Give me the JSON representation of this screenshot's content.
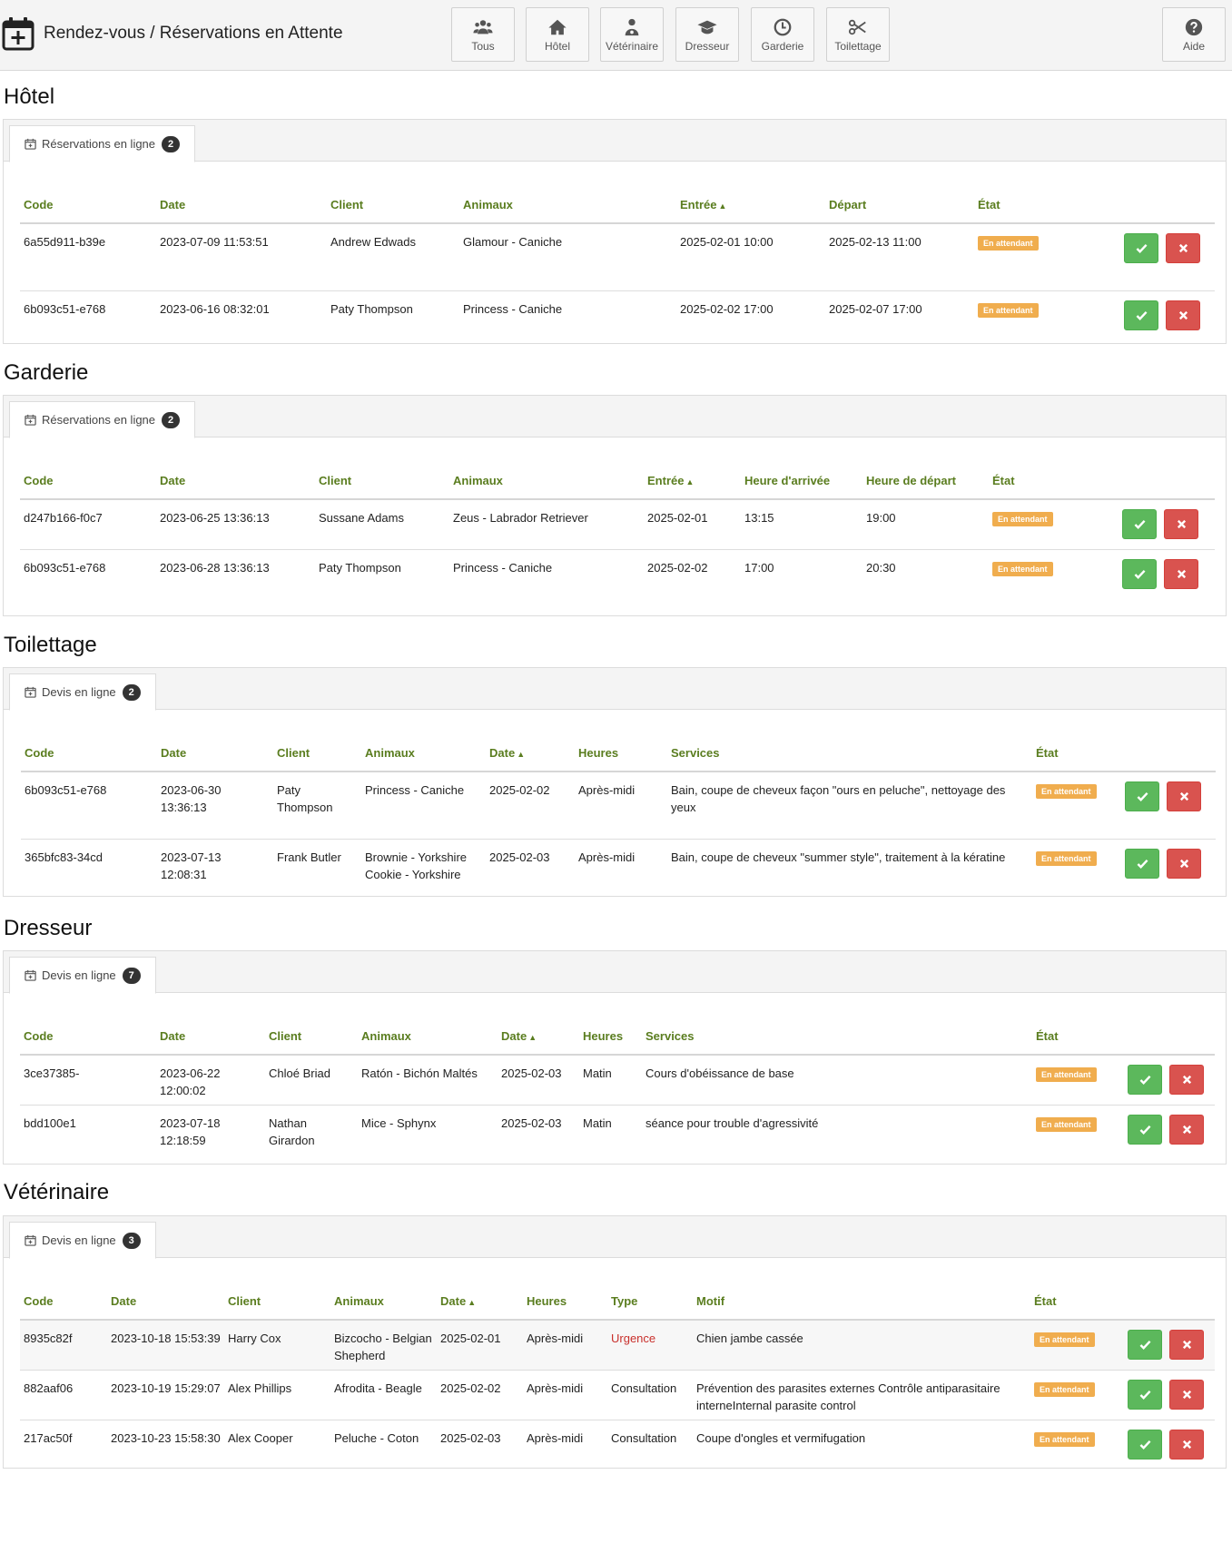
{
  "header": {
    "title": "Rendez-vous / Réservations en Attente",
    "nav": [
      {
        "label": "Tous",
        "icon": "users-icon"
      },
      {
        "label": "Hôtel",
        "icon": "home-icon"
      },
      {
        "label": "Vétérinaire",
        "icon": "doctor-icon"
      },
      {
        "label": "Dresseur",
        "icon": "graduation-cap-icon"
      },
      {
        "label": "Garderie",
        "icon": "clock-icon"
      },
      {
        "label": "Toilettage",
        "icon": "scissors-icon"
      }
    ],
    "help": {
      "label": "Aide",
      "icon": "question-icon"
    }
  },
  "status_label": "En attendant",
  "colors": {
    "accent": "#5a7d1f",
    "status": "#f0ad4e",
    "accept": "#5cb85c",
    "reject": "#d9534f",
    "urgent": "#c9302c"
  },
  "hotel": {
    "title": "Hôtel",
    "tab": {
      "label": "Réservations en ligne",
      "count": "2"
    },
    "columns": [
      "Code",
      "Date",
      "Client",
      "Animaux",
      "Entrée",
      "Départ",
      "État"
    ],
    "rows": [
      {
        "code": "6a55d911-b39e",
        "date": "2023-07-09 11:53:51",
        "client": "Andrew Edwads",
        "animals": "Glamour - Caniche",
        "in": "2025-02-01 10:00",
        "out": "2025-02-13 11:00"
      },
      {
        "code": "6b093c51-e768",
        "date": "2023-06-16 08:32:01",
        "client": "Paty Thompson",
        "animals": "Princess - Caniche",
        "in": "2025-02-02 17:00",
        "out": "2025-02-07 17:00"
      }
    ]
  },
  "garderie": {
    "title": "Garderie",
    "tab": {
      "label": "Réservations en ligne",
      "count": "2"
    },
    "columns": [
      "Code",
      "Date",
      "Client",
      "Animaux",
      "Entrée",
      "Heure d'arrivée",
      "Heure de départ",
      "État"
    ],
    "rows": [
      {
        "code": "d247b166-f0c7",
        "date": "2023-06-25 13:36:13",
        "client": "Sussane Adams",
        "animals": "Zeus - Labrador Retriever",
        "in": "2025-02-01",
        "arrive": "13:15",
        "depart": "19:00"
      },
      {
        "code": "6b093c51-e768",
        "date": "2023-06-28 13:36:13",
        "client": "Paty Thompson",
        "animals": "Princess - Caniche",
        "in": "2025-02-02",
        "arrive": "17:00",
        "depart": "20:30"
      }
    ]
  },
  "toilettage": {
    "title": "Toilettage",
    "tab": {
      "label": "Devis en ligne",
      "count": "2"
    },
    "columns": [
      "Code",
      "Date",
      "Client",
      "Animaux",
      "Date",
      "Heures",
      "Services",
      "État"
    ],
    "rows": [
      {
        "code": "6b093c51-e768",
        "date": "2023-06-30 13:36:13",
        "client": "Paty Thompson",
        "animals": "Princess - Caniche",
        "rdv": "2025-02-02",
        "hours": "Après-midi",
        "services": "Bain, coupe de cheveux façon \"ours en peluche\", nettoyage des yeux"
      },
      {
        "code": "365bfc83-34cd",
        "date": "2023-07-13 12:08:31",
        "client": "Frank Butler",
        "animals": "Brownie - Yorkshire Cookie - Yorkshire",
        "rdv": "2025-02-03",
        "hours": "Après-midi",
        "services": "Bain, coupe de cheveux \"summer style\", traitement à la kératine"
      }
    ]
  },
  "dresseur": {
    "title": "Dresseur",
    "tab": {
      "label": "Devis en ligne",
      "count": "7"
    },
    "columns": [
      "Code",
      "Date",
      "Client",
      "Animaux",
      "Date",
      "Heures",
      "Services",
      "État"
    ],
    "rows": [
      {
        "code": "3ce37385-",
        "date": "2023-06-22 12:00:02",
        "client": "Chloé Briad",
        "animals": "Ratón - Bichón Maltés",
        "rdv": "2025-02-03",
        "hours": "Matin",
        "services": "Cours d'obéissance de base"
      },
      {
        "code": "bdd100e1",
        "date": "2023-07-18 12:18:59",
        "client": "Nathan Girardon",
        "animals": "Mice - Sphynx",
        "rdv": "2025-02-03",
        "hours": "Matin",
        "services": "séance pour trouble d'agressivité"
      }
    ]
  },
  "veterinaire": {
    "title": "Vétérinaire",
    "tab": {
      "label": "Devis en ligne",
      "count": "3"
    },
    "columns": [
      "Code",
      "Date",
      "Client",
      "Animaux",
      "Date",
      "Heures",
      "Type",
      "Motif",
      "État"
    ],
    "rows": [
      {
        "code": "8935c82f",
        "date": "2023-10-18 15:53:39",
        "client": "Harry Cox",
        "animals": "Bizcocho - Belgian Shepherd",
        "rdv": "2025-02-01",
        "hours": "Après-midi",
        "type": "Urgence",
        "motif": "Chien jambe cassée"
      },
      {
        "code": "882aaf06",
        "date": "2023-10-19 15:29:07",
        "client": "Alex  Phillips",
        "animals": "Afrodita - Beagle",
        "rdv": "2025-02-02",
        "hours": "Après-midi",
        "type": "Consultation",
        "motif": "Prévention des parasites externes Contrôle antiparasitaire interneInternal parasite control"
      },
      {
        "code": "217ac50f",
        "date": "2023-10-23 15:58:30",
        "client": "Alex Cooper",
        "animals": "Peluche - Coton",
        "rdv": "2025-02-03",
        "hours": "Après-midi",
        "type": "Consultation",
        "motif": "Coupe d'ongles et vermifugation"
      }
    ]
  }
}
